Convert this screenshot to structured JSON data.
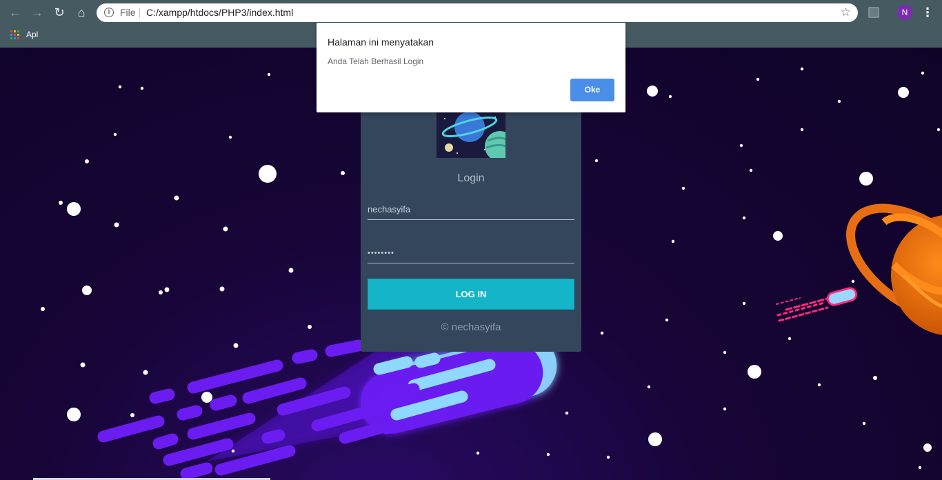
{
  "browser": {
    "back_icon": "back-arrow",
    "forward_icon": "forward-arrow",
    "reload_icon": "reload",
    "home_icon": "home",
    "scheme_label": "File",
    "url": "C:/xampp/htdocs/PHP3/index.html",
    "profile_initial": "N",
    "bookmark_apps_label": "Apl"
  },
  "dialog": {
    "title": "Halaman ini menyatakan",
    "message": "Anda Telah Berhasil Login",
    "ok_label": "Oke"
  },
  "login": {
    "title": "Login",
    "username_value": "nechasyifa",
    "password_value": "••••••••",
    "button_label": "LOG IN",
    "footer": "© nechasyifa"
  },
  "colors": {
    "chrome": "#465a62",
    "card": "#34465c",
    "button": "#14b4c9",
    "dialog_ok": "#4a8ee8",
    "background": "#160536",
    "comet": "#6b1cf0",
    "planet": "#ff7a10"
  }
}
